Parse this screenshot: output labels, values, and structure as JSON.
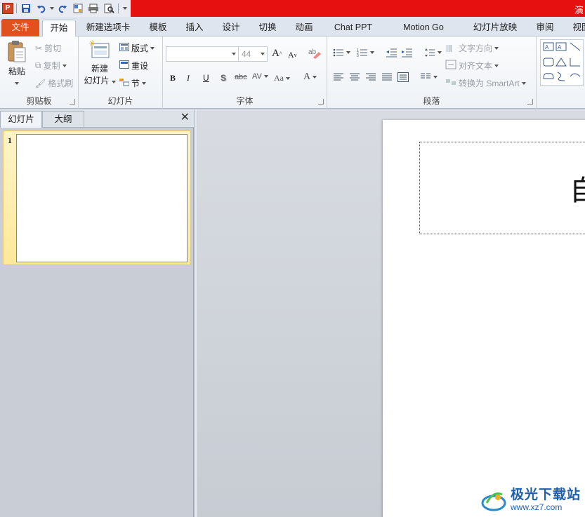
{
  "app": {
    "icon_letter": "P",
    "window_title_fragment": "演"
  },
  "tabs": [
    {
      "label": "文件"
    },
    {
      "label": "开始"
    },
    {
      "label": "新建选项卡"
    },
    {
      "label": "模板"
    },
    {
      "label": "插入"
    },
    {
      "label": "设计"
    },
    {
      "label": "切换"
    },
    {
      "label": "动画"
    },
    {
      "label": "Chat PPT"
    },
    {
      "label": "Motion Go"
    },
    {
      "label": "幻灯片放映"
    },
    {
      "label": "审阅"
    },
    {
      "label": "视图"
    }
  ],
  "ribbon": {
    "clipboard": {
      "label": "剪贴板",
      "paste": "粘贴",
      "cut": "剪切",
      "copy": "复制",
      "format_painter": "格式刷"
    },
    "slides": {
      "label": "幻灯片",
      "new_slide_line1": "新建",
      "new_slide_line2": "幻灯片",
      "layout": "版式",
      "reset": "重设",
      "section": "节"
    },
    "font": {
      "label": "字体",
      "font_name": "",
      "font_size": "44",
      "bold": "B",
      "italic": "I",
      "underline": "U",
      "shadow": "S",
      "strike": "abc",
      "spacing": "AV",
      "case": "Aa",
      "color": "A",
      "grow": "A",
      "shrink": "A"
    },
    "paragraph": {
      "label": "段落",
      "text_direction": "文字方向",
      "align_text": "对齐文本",
      "convert_smartart": "转换为 SmartArt"
    }
  },
  "left_pane": {
    "tabs": [
      "幻灯片",
      "大纲"
    ],
    "close": "✕",
    "slide_number": "1"
  },
  "slide": {
    "title_char": "自"
  },
  "watermark": {
    "title": "极光下载站",
    "url": "www.xz7.com"
  },
  "colors": {
    "file_tab": "#e1511e",
    "title_bar": "#e61010",
    "thumb_highlight": "#fde89a"
  }
}
